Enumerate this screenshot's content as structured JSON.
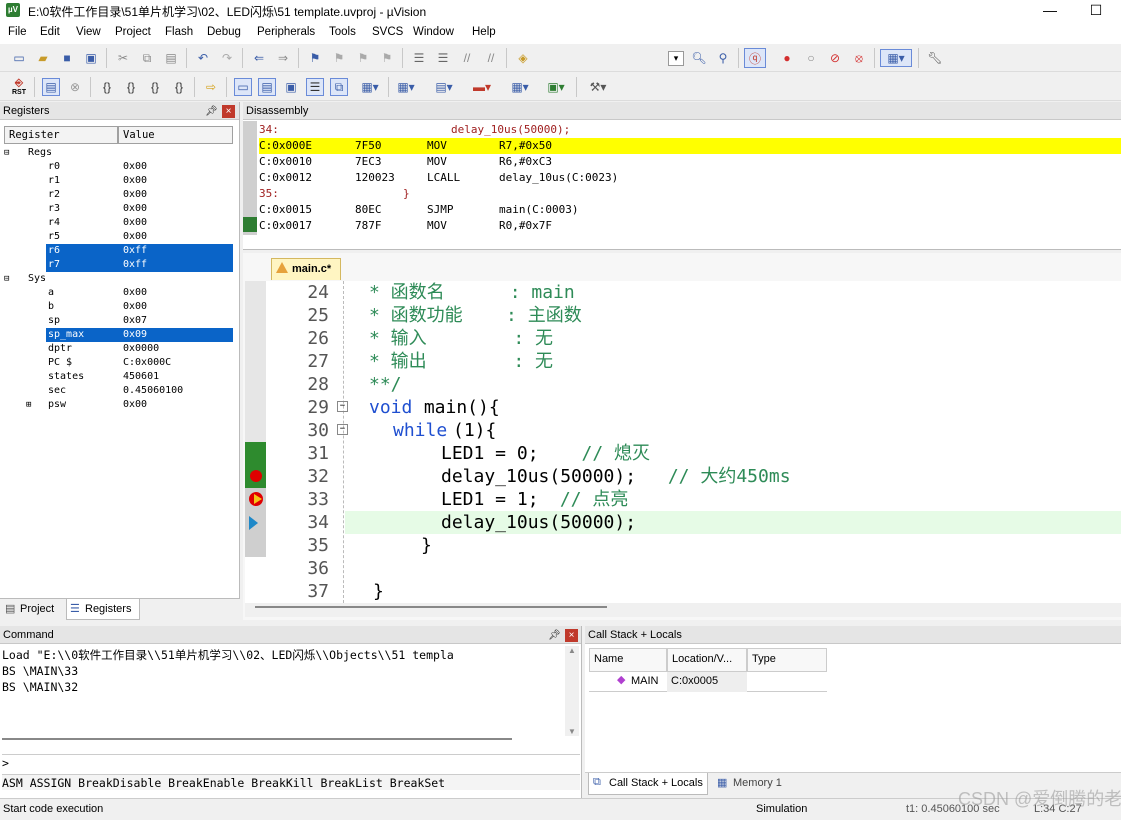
{
  "window": {
    "title": "E:\\0软件工作目录\\51单片机学习\\02、LED闪烁\\51 template.uvproj - µVision",
    "minimize": "—",
    "maximize": "☐"
  },
  "menu": [
    "File",
    "Edit",
    "View",
    "Project",
    "Flash",
    "Debug",
    "Peripherals",
    "Tools",
    "SVCS",
    "Window",
    "Help"
  ],
  "toolbar": {
    "rst_label": "RST"
  },
  "registers": {
    "title": "Registers",
    "col_register": "Register",
    "col_value": "Value",
    "group_regs": "Regs",
    "group_sys": "Sys",
    "regs": [
      {
        "name": "r0",
        "value": "0x00"
      },
      {
        "name": "r1",
        "value": "0x00"
      },
      {
        "name": "r2",
        "value": "0x00"
      },
      {
        "name": "r3",
        "value": "0x00"
      },
      {
        "name": "r4",
        "value": "0x00"
      },
      {
        "name": "r5",
        "value": "0x00"
      },
      {
        "name": "r6",
        "value": "0xff"
      },
      {
        "name": "r7",
        "value": "0xff"
      }
    ],
    "sys": [
      {
        "name": "a",
        "value": "0x00"
      },
      {
        "name": "b",
        "value": "0x00"
      },
      {
        "name": "sp",
        "value": "0x07"
      },
      {
        "name": "sp_max",
        "value": "0x09"
      },
      {
        "name": "dptr",
        "value": "0x0000"
      },
      {
        "name": "PC  $",
        "value": "C:0x000C"
      },
      {
        "name": "states",
        "value": "450601"
      },
      {
        "name": "sec",
        "value": "0.45060100"
      },
      {
        "name": "psw",
        "value": "0x00"
      }
    ],
    "tab_project": "Project",
    "tab_registers": "Registers"
  },
  "disassembly": {
    "title": "Disassembly",
    "lines": [
      {
        "addr": "    34:",
        "op": "",
        "mn": "",
        "arg": "delay_10us(50000);"
      },
      {
        "addr": "C:0x000E",
        "op": "7F50",
        "mn": "MOV",
        "arg": "R7,#0x50"
      },
      {
        "addr": "C:0x0010",
        "op": "7EC3",
        "mn": "MOV",
        "arg": "R6,#0xC3"
      },
      {
        "addr": "C:0x0012",
        "op": "120023",
        "mn": "LCALL",
        "arg": "delay_10us(C:0023)"
      },
      {
        "addr": "    35:",
        "op": "",
        "mn": "",
        "arg": "}"
      },
      {
        "addr": "C:0x0015",
        "op": "80EC",
        "mn": "SJMP",
        "arg": "main(C:0003)"
      },
      {
        "addr": "C:0x0017",
        "op": "787F",
        "mn": "MOV",
        "arg": "R0,#0x7F"
      }
    ]
  },
  "editor": {
    "tab": "main.c*",
    "lines": [
      {
        "n": "24",
        "t": "* 函数名      : main"
      },
      {
        "n": "25",
        "t": "* 函数功能    : 主函数"
      },
      {
        "n": "26",
        "t": "* 输入        : 无"
      },
      {
        "n": "27",
        "t": "* 输出        : 无"
      },
      {
        "n": "28",
        "t": "**/"
      },
      {
        "n": "29",
        "kw": "void",
        "t": " main(){"
      },
      {
        "n": "30",
        "kw": "while",
        "t": "(1){"
      },
      {
        "n": "31",
        "t": "LED1 = 0;",
        "c": "   // 熄灭"
      },
      {
        "n": "32",
        "t": "delay_10us(50000);",
        "c": " // 大约450ms"
      },
      {
        "n": "33",
        "t": "LED1 = 1;",
        "c": " // 点亮"
      },
      {
        "n": "34",
        "t": "delay_10us(50000);"
      },
      {
        "n": "35",
        "t": "}"
      },
      {
        "n": "36",
        "t": ""
      },
      {
        "n": "37",
        "t": "}"
      }
    ]
  },
  "command": {
    "title": "Command",
    "lines": [
      "Load \"E:\\\\0软件工作目录\\\\51单片机学习\\\\02、LED闪烁\\\\Objects\\\\51 templa",
      "BS \\MAIN\\33",
      "BS \\MAIN\\32"
    ],
    "prompt": ">",
    "hint": "ASM ASSIGN BreakDisable BreakEnable BreakKill BreakList BreakSet"
  },
  "callstack": {
    "title": "Call Stack + Locals",
    "cols": [
      "Name",
      "Location/V...",
      "Type"
    ],
    "row": {
      "name": "MAIN",
      "location": "C:0x0005",
      "type": ""
    },
    "tab_callstack": "Call Stack + Locals",
    "tab_memory": "Memory 1"
  },
  "status": {
    "left": "Start code execution",
    "mode": "Simulation",
    "time": "t1: 0.45060100 sec",
    "pos": "L:34 C:27",
    "watermark": "CSDN @爱倒腾的老唐"
  }
}
